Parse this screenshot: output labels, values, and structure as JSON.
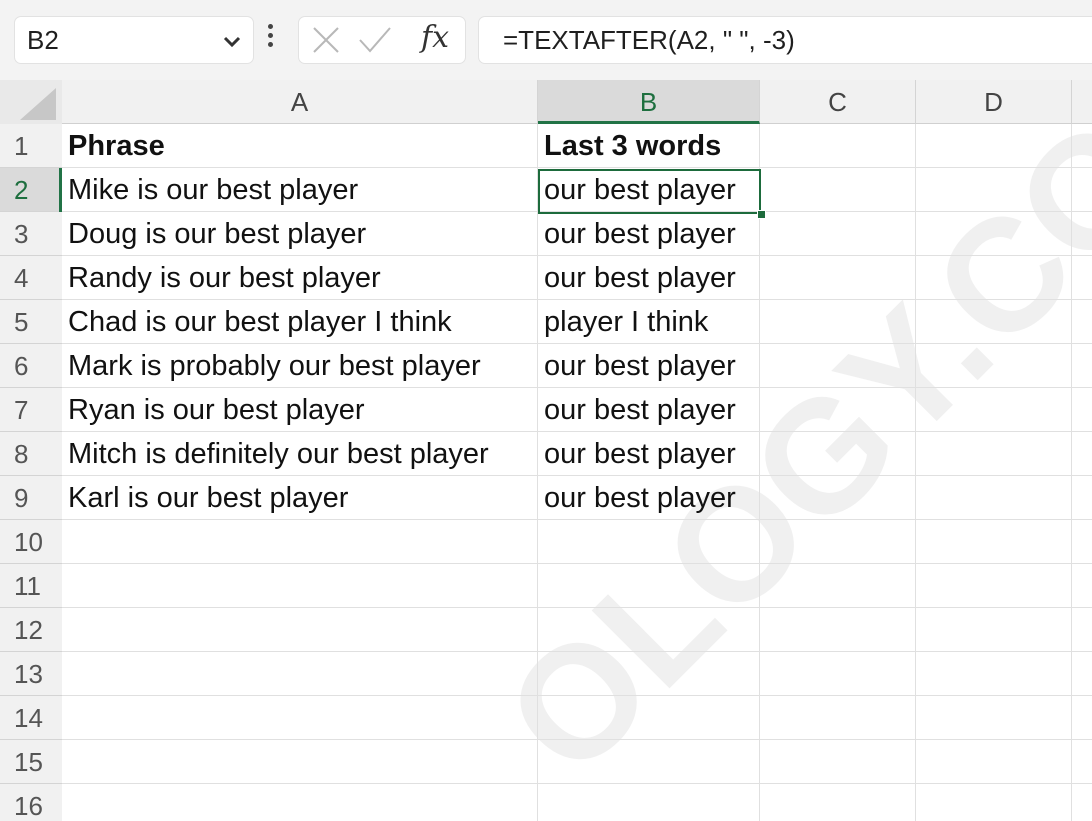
{
  "formula_bar": {
    "name_box": "B2",
    "formula": "=TEXTAFTER(A2, \" \", -3)",
    "icons": [
      "chevron-down-icon",
      "more-options-icon",
      "cancel-icon",
      "enter-icon",
      "insert-function-icon"
    ],
    "insert_function_label": "fx"
  },
  "columns": [
    "A",
    "B",
    "C",
    "D"
  ],
  "selected_column": "B",
  "selected_row": "2",
  "rows": [
    {
      "num": "1",
      "a": "Phrase",
      "b": "Last 3 words"
    },
    {
      "num": "2",
      "a": "Mike is our best player",
      "b": "our best player"
    },
    {
      "num": "3",
      "a": "Doug is our best player",
      "b": "our best player"
    },
    {
      "num": "4",
      "a": "Randy is our best player",
      "b": "our best player"
    },
    {
      "num": "5",
      "a": "Chad is our best player I think",
      "b": "player I think"
    },
    {
      "num": "6",
      "a": "Mark is probably our best player",
      "b": "our best player"
    },
    {
      "num": "7",
      "a": "Ryan is our best player",
      "b": "our best player"
    },
    {
      "num": "8",
      "a": "Mitch is definitely our best player",
      "b": "our best player"
    },
    {
      "num": "9",
      "a": "Karl is our best player",
      "b": "our best player"
    },
    {
      "num": "10",
      "a": "",
      "b": ""
    },
    {
      "num": "11",
      "a": "",
      "b": ""
    },
    {
      "num": "12",
      "a": "",
      "b": ""
    },
    {
      "num": "13",
      "a": "",
      "b": ""
    },
    {
      "num": "14",
      "a": "",
      "b": ""
    },
    {
      "num": "15",
      "a": "",
      "b": ""
    },
    {
      "num": "16",
      "a": "",
      "b": ""
    }
  ],
  "watermark": "OLOGY.CO",
  "colors": {
    "accent": "#217346",
    "header_bg": "#f1f1f1",
    "selected_header_bg": "#dadada"
  }
}
